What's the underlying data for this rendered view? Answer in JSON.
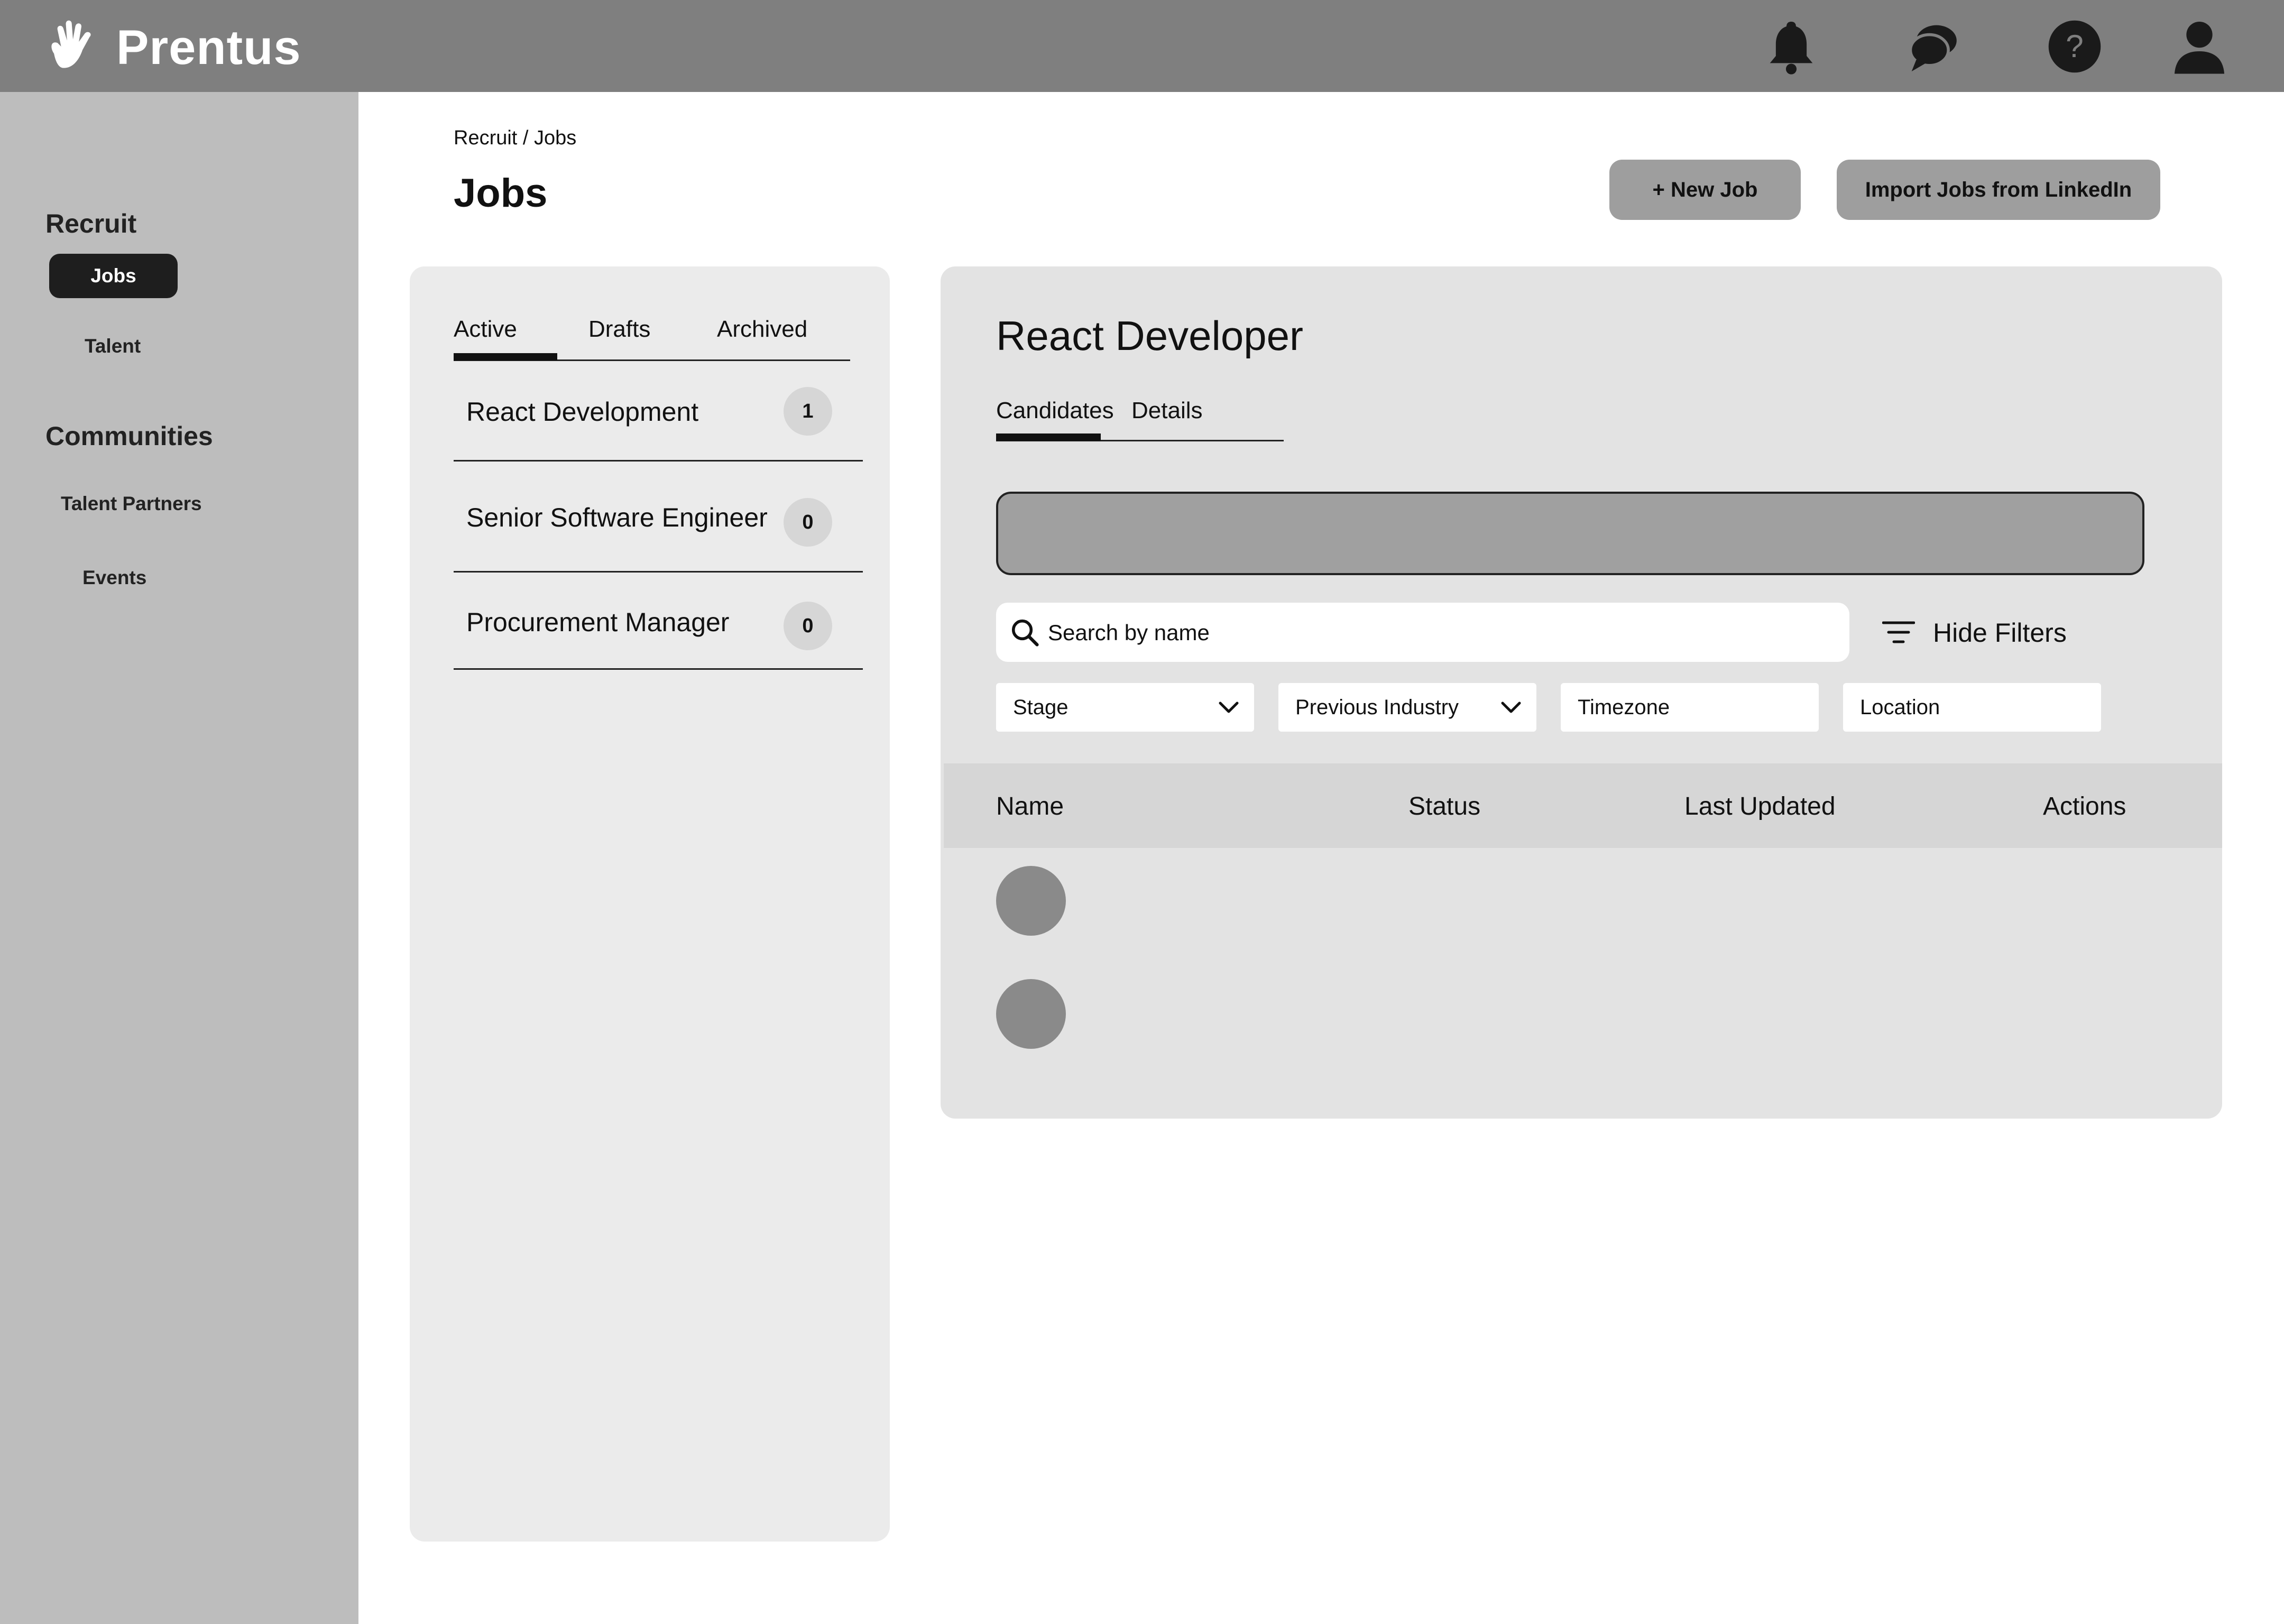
{
  "app": {
    "brand": "Prentus"
  },
  "topbar": {
    "icons": [
      "bell-icon",
      "chat-icon",
      "help-icon",
      "profile-icon"
    ]
  },
  "sidebar": {
    "recruit_heading": "Recruit",
    "recruit_items": [
      {
        "label": "Jobs",
        "active": true
      },
      {
        "label": "Talent",
        "active": false
      }
    ],
    "communities_heading": "Communities",
    "communities_items": [
      {
        "label": "Talent Partners"
      },
      {
        "label": "Events"
      }
    ]
  },
  "header": {
    "breadcrumb": "Recruit / Jobs",
    "title": "Jobs",
    "new_job_label": "+ New Job",
    "import_label": "Import Jobs from LinkedIn"
  },
  "jobs_panel": {
    "tabs": [
      {
        "label": "Active",
        "selected": true
      },
      {
        "label": "Drafts",
        "selected": false
      },
      {
        "label": "Archived",
        "selected": false
      }
    ],
    "jobs": [
      {
        "title": "React Development",
        "count": "1"
      },
      {
        "title": "Senior Software Engineer",
        "count": "0"
      },
      {
        "title": "Procurement Manager",
        "count": "0"
      }
    ]
  },
  "detail": {
    "title": "React Developer",
    "tabs": [
      {
        "label": "Candidates",
        "selected": true
      },
      {
        "label": "Details",
        "selected": false
      }
    ],
    "search": {
      "placeholder": "Search by name",
      "value": ""
    },
    "hide_filters_label": "Hide Filters",
    "filters": [
      {
        "label": "Stage",
        "dropdown": true
      },
      {
        "label": "Previous Industry",
        "dropdown": true
      },
      {
        "label": "Timezone",
        "dropdown": false
      },
      {
        "label": "Location",
        "dropdown": false
      }
    ],
    "table": {
      "columns": [
        "Name",
        "Status",
        "Last Updated",
        "Actions"
      ],
      "rows": [
        {
          "avatar": "avatar"
        },
        {
          "avatar": "avatar"
        }
      ]
    }
  },
  "colors": {
    "topbar": "#7f7f7f",
    "sidebar": "#bdbdbd",
    "active_nav": "#1e1e1e",
    "button": "#9e9e9e",
    "panel": "#ebebeb",
    "detail_panel": "#e3e3e3"
  }
}
